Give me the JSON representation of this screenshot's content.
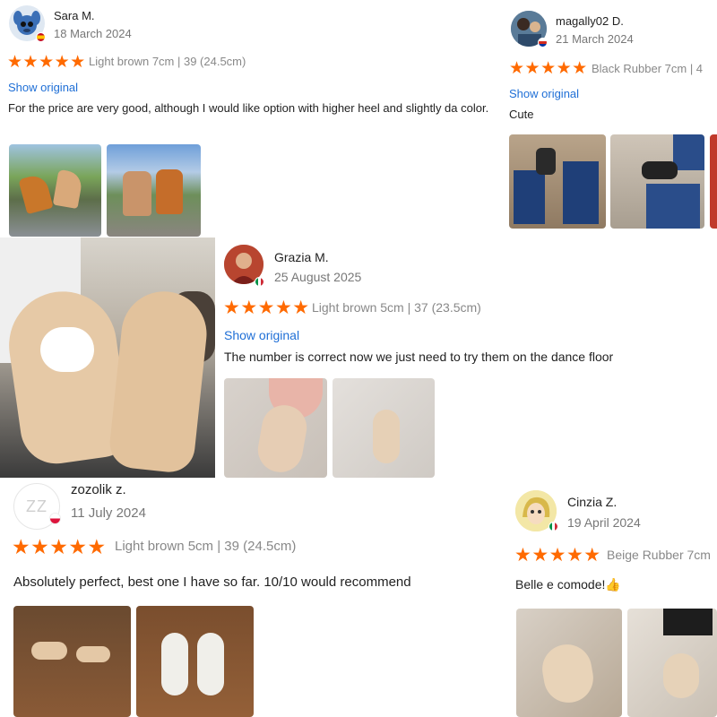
{
  "colors": {
    "star": "#ff6a00",
    "link": "#1f6fd6",
    "muted": "#888888",
    "text": "#222222"
  },
  "reviews": [
    {
      "name": "Sara M.",
      "date": "18 March 2024",
      "stars": "★★★★★",
      "variant": "Light brown 7cm | 39 (24.5cm)",
      "show": "Show original",
      "text": "For the price are very good, although I would like option with higher heel and slightly da color.",
      "avatar_icon": "cartoon-avatar-icon"
    },
    {
      "name": "magally02 D.",
      "date": "21 March 2024",
      "stars": "★★★★★",
      "variant": "Black Rubber 7cm | 4",
      "show": "Show original",
      "text": "Cute",
      "avatar_icon": "photo-avatar-icon"
    },
    {
      "name": "Grazia M.",
      "date": "25 August 2025",
      "stars": "★★★★★",
      "variant": "Light brown 5cm | 37 (23.5cm)",
      "show": "Show original",
      "text": "The number is correct now we just need to try them on the dance floor",
      "avatar_icon": "photo-avatar-icon"
    },
    {
      "name": "zozolik z.",
      "date": "11 July 2024",
      "stars": "★★★★★",
      "variant": "Light brown 5cm | 39 (24.5cm)",
      "text": "Absolutely perfect, best one I have so far. 10/10 would recommend",
      "avatar_initials": "ZZ"
    },
    {
      "name": "Cinzia Z.",
      "date": "19 April 2024",
      "stars": "★★★★★",
      "variant": "Beige Rubber 7cm",
      "text": "Belle e comode!👍",
      "avatar_icon": "cartoon-avatar-icon"
    }
  ]
}
